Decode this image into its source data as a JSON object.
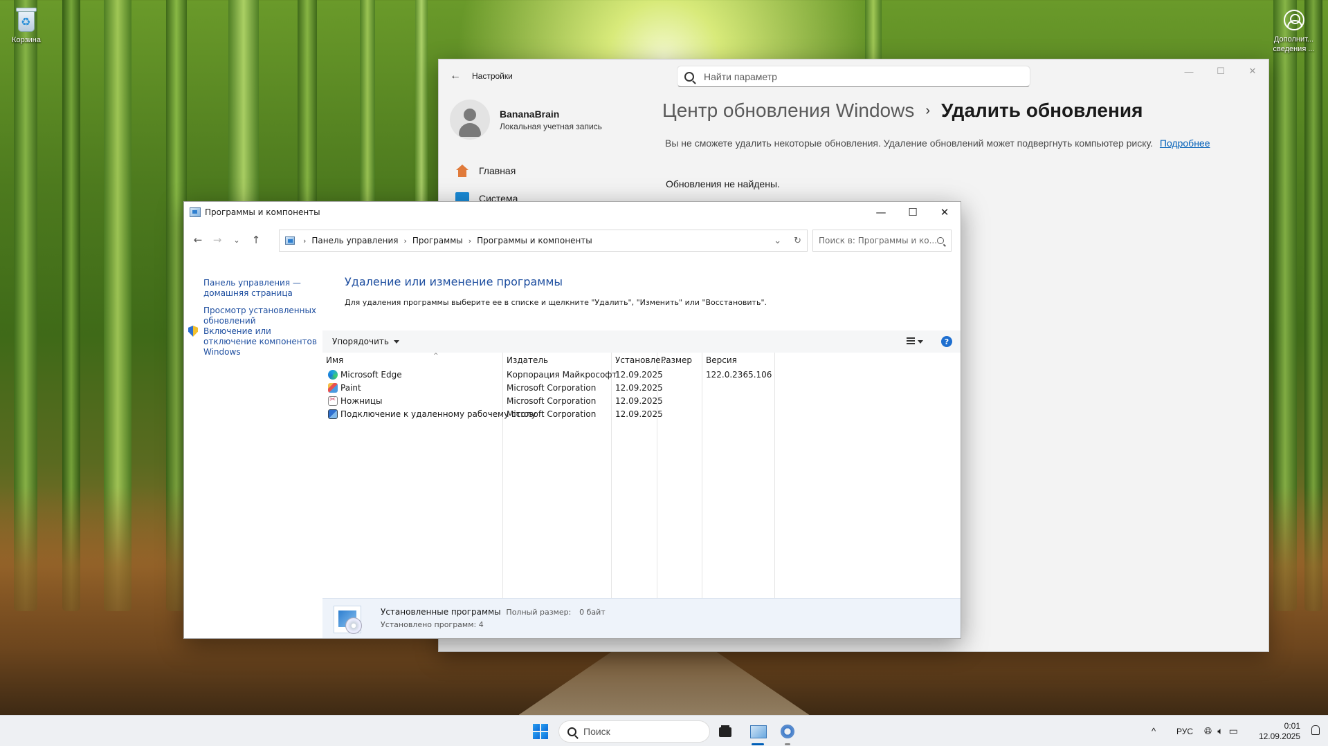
{
  "desktop": {
    "recycle_bin": "Корзина",
    "user_icon": "Дополнит... сведения ..."
  },
  "settings": {
    "title": "Настройки",
    "search_placeholder": "Найти параметр",
    "user": {
      "name": "BananaBrain",
      "account": "Локальная учетная запись"
    },
    "nav": [
      {
        "label": "Главная",
        "icon": "home-icon"
      },
      {
        "label": "Система",
        "icon": "system-icon"
      }
    ],
    "breadcrumb": {
      "parent": "Центр обновления Windows",
      "separator": "›",
      "current": "Удалить обновления"
    },
    "warning": "Вы не сможете удалить некоторые обновления. Удаление обновлений может подвергнуть компьютер риску.",
    "learn_more": "Подробнее",
    "no_updates": "Обновления не найдены."
  },
  "programs": {
    "title": "Программы и компоненты",
    "address": [
      "Панель управления",
      "Программы",
      "Программы и компоненты"
    ],
    "search_placeholder": "Поиск в: Программы и ко...",
    "sidebar": [
      "Панель управления — домашняя страница",
      "Просмотр установленных обновлений",
      "Включение или отключение компонентов Windows"
    ],
    "heading": "Удаление или изменение программы",
    "description": "Для удаления программы выберите ее в списке и щелкните \"Удалить\", \"Изменить\" или \"Восстановить\".",
    "organize": "Упорядочить",
    "columns": [
      "Имя",
      "Издатель",
      "Установле...",
      "Размер",
      "Версия"
    ],
    "rows": [
      {
        "name": "Microsoft Edge",
        "publisher": "Корпорация Майкрософт",
        "installed": "12.09.2025",
        "size": "",
        "version": "122.0.2365.106",
        "icon": "edge-icon"
      },
      {
        "name": "Paint",
        "publisher": "Microsoft Corporation",
        "installed": "12.09.2025",
        "size": "",
        "version": "",
        "icon": "paint-icon"
      },
      {
        "name": "Ножницы",
        "publisher": "Microsoft Corporation",
        "installed": "12.09.2025",
        "size": "",
        "version": "",
        "icon": "snipping-icon"
      },
      {
        "name": "Подключение к удаленному рабочему столу",
        "publisher": "Microsoft Corporation",
        "installed": "12.09.2025",
        "size": "",
        "version": "",
        "icon": "remote-desktop-icon"
      }
    ],
    "status": {
      "title": "Установленные программы",
      "size_label": "Полный размер:",
      "size_value": "0 байт",
      "count": "Установлено программ: 4"
    }
  },
  "taskbar": {
    "search": "Поиск",
    "language": "РУС",
    "time": "0:01",
    "date": "12.09.2025"
  }
}
